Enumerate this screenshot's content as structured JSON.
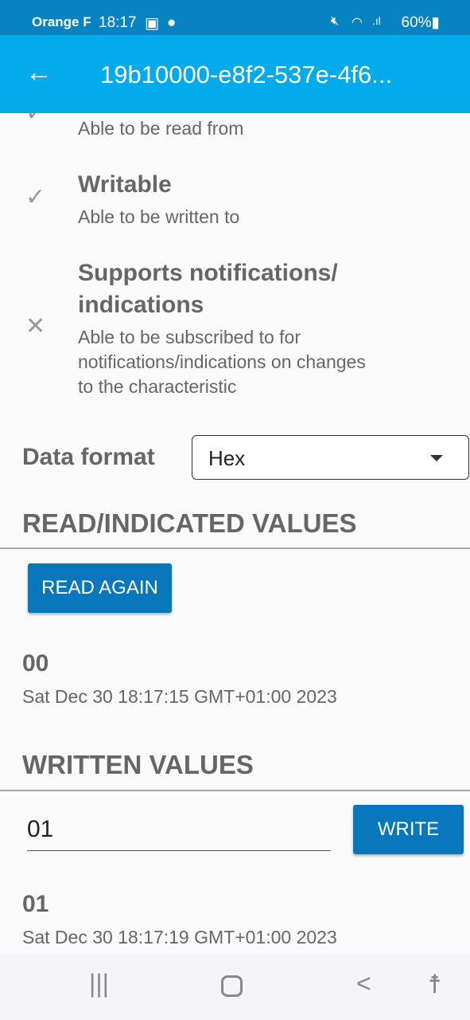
{
  "status_bar": {
    "carrier": "Orange F",
    "time": "18:17",
    "battery": "60%",
    "icons": [
      "image-icon",
      "bulb-icon",
      "mute-icon",
      "wifi-icon",
      "signal-icon",
      "battery-icon"
    ]
  },
  "app_bar": {
    "title": "19b10000-e8f2-537e-4f6...",
    "back_icon": "arrow-left-icon"
  },
  "properties": [
    {
      "title": "",
      "desc": "Able to be read from",
      "icon": "check-icon"
    },
    {
      "title": "Writable",
      "desc": "Able to be written to",
      "icon": "check-icon"
    },
    {
      "title": "Supports notifications/ indications",
      "title_l1": "Supports notifications/",
      "title_l2": "indications",
      "desc_l1": "Able to be subscribed to for",
      "desc_l2": "notifications/indications on changes",
      "desc_l3": "to the characteristic",
      "icon": "close-icon"
    }
  ],
  "data_format": {
    "label": "Data format",
    "value": "Hex"
  },
  "read": {
    "heading": "READ/INDICATED VALUES",
    "button": "READ AGAIN",
    "value": "00",
    "timestamp": "Sat Dec 30 18:17:15 GMT+01:00 2023"
  },
  "written": {
    "heading": "WRITTEN VALUES",
    "input": "01",
    "button": "WRITE",
    "value": "01",
    "timestamp": "Sat Dec 30 18:17:19 GMT+01:00 2023"
  },
  "colors": {
    "status": "#0783c2",
    "appbar": "#03abec",
    "button": "#0877bb"
  }
}
